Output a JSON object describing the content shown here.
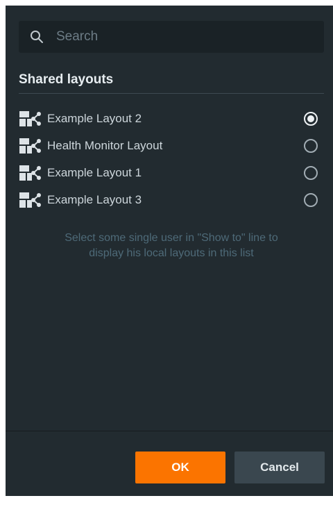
{
  "search": {
    "placeholder": "Search",
    "value": ""
  },
  "section": {
    "title": "Shared layouts"
  },
  "layouts": [
    {
      "label": "Example Layout 2",
      "selected": true
    },
    {
      "label": "Health Monitor Layout",
      "selected": false
    },
    {
      "label": "Example Layout 1",
      "selected": false
    },
    {
      "label": "Example Layout 3",
      "selected": false
    }
  ],
  "hint": {
    "line1": "Select some single user in \"Show to\" line to",
    "line2": "display his local layouts in this list"
  },
  "buttons": {
    "ok": "OK",
    "cancel": "Cancel"
  },
  "icons": {
    "search": "search-icon",
    "layout": "shared-layout-icon"
  },
  "colors": {
    "background": "#222b30",
    "accent": "#fb7400",
    "hint": "#4e6a78"
  }
}
